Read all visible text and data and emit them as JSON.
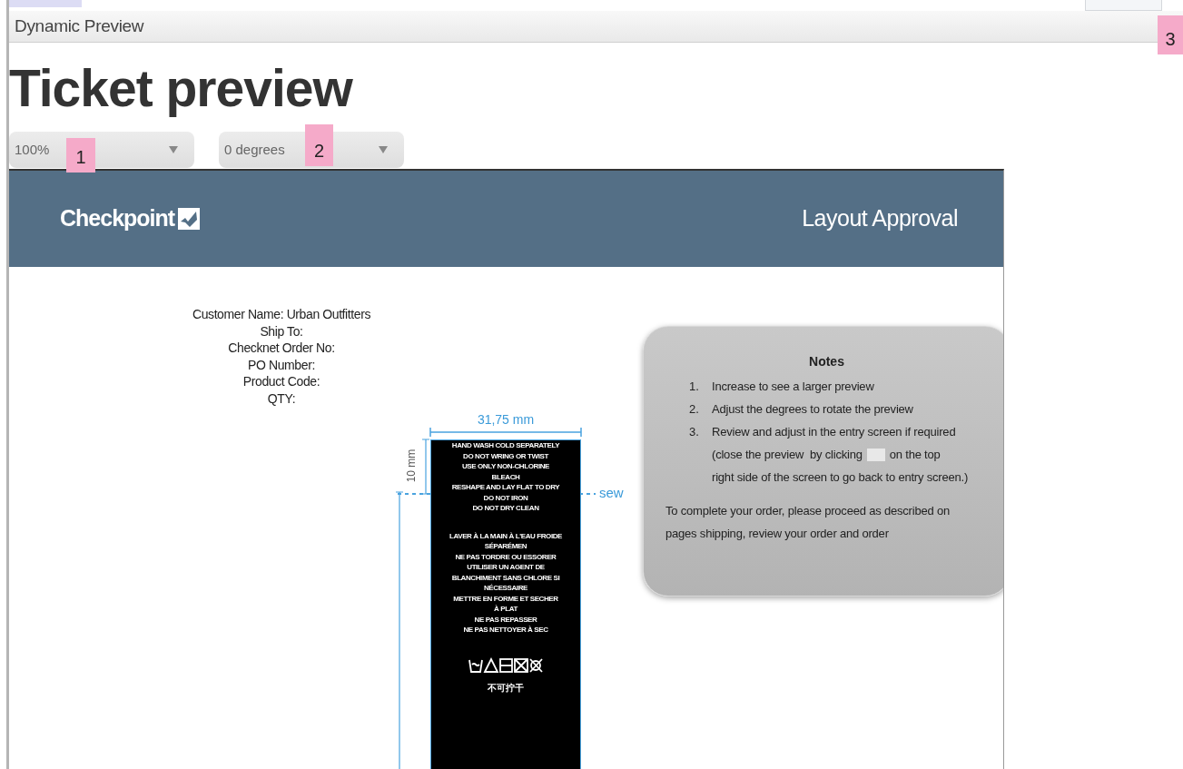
{
  "window": {
    "title": "Dynamic Preview"
  },
  "heading": "Ticket preview",
  "controls": [
    {
      "kind": "select",
      "value": "100%"
    },
    {
      "kind": "select",
      "value": "0 degrees"
    }
  ],
  "callouts": [
    "1",
    "2",
    "3"
  ],
  "preview": {
    "brand": "Checkpoint",
    "header_title": "Layout Approval",
    "customer_info": [
      "Customer Name: Urban Outfitters",
      "Ship To:",
      "Checknet Order No:",
      "PO Number:",
      "Product Code:",
      "QTY:"
    ],
    "label": {
      "width_dimension": "31,75 mm",
      "height_dimension": "10 mm",
      "sew_mark": "sew",
      "care_groups": [
        [
          "HAND WASH COLD SEPARATELY",
          "DO NOT WRING OR TWIST",
          "USE ONLY NON-CHLORINE",
          "BLEACH",
          "RESHAPE AND LAY FLAT TO DRY",
          "DO NOT IRON",
          "DO NOT DRY CLEAN"
        ],
        [
          "LAVER À LA MAIN À L'EAU FROIDE",
          "SÉPARÉMEN",
          "NE PAS TORDRE OU ESSORER",
          "UTILISER UN AGENT DE",
          "BLANCHIMENT SANS CHLORE SI",
          "NÉCESSAIRE",
          "METTRE EN FORME ET SECHER",
          "À PLAT",
          "NE PAS REPASSER",
          "NE PAS NETTOYER À SEC"
        ]
      ],
      "cjk_line": "不可拧干"
    }
  },
  "notes": {
    "title": "Notes",
    "items": [
      {
        "number": "1.",
        "text": "Increase to see a larger preview"
      },
      {
        "number": "2.",
        "text": "Adjust the degrees to rotate the preview"
      },
      {
        "number": "3.",
        "text": "Review and adjust in the entry screen if required",
        "line_before_icon": "(close the preview  by clicking",
        "line_after_icon": "on the top",
        "text_rest": "right side of the screen to go back to entry screen.)"
      }
    ],
    "footer": "To complete your order, please proceed as described on pages shipping, review your order and order"
  }
}
